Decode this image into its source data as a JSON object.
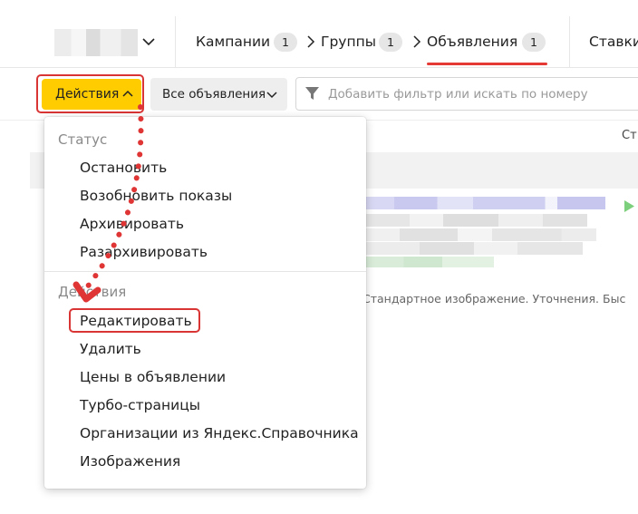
{
  "nav": {
    "crumbs": [
      {
        "label": "Кампании",
        "count": "1"
      },
      {
        "label": "Группы",
        "count": "1"
      },
      {
        "label": "Объявления",
        "count": "1"
      }
    ],
    "next_tab": "Ставки"
  },
  "toolbar": {
    "actions_label": "Действия",
    "all_ads_label": "Все объявления",
    "filter_placeholder": "Добавить фильтр или искать по номеру"
  },
  "table": {
    "column_header_partial": "Ст",
    "ad_caption": "Стандартное изображение. Уточнения. Быс"
  },
  "dropdown": {
    "status_group": {
      "label": "Статус",
      "items": [
        "Остановить",
        "Возобновить показы",
        "Архивировать",
        "Разархивировать"
      ]
    },
    "actions_group": {
      "label": "Действия",
      "items": [
        "Редактировать",
        "Удалить",
        "Цены в объявлении",
        "Турбо-страницы",
        "Организации из Яндекс.Справочника",
        "Изображения"
      ]
    }
  },
  "colors": {
    "actions_button": "#ffcc00",
    "highlight_frame": "#d93535",
    "active_tab_underline": "#e53935",
    "annotation_dots": "#e03535"
  },
  "icons": {
    "account_chevron": "chevron-down-icon",
    "breadcrumb_separator": "chevron-right-icon",
    "actions_chevron": "chevron-up-icon",
    "all_ads_chevron": "chevron-down-icon",
    "filter": "funnel-icon",
    "ad_status": "play-icon"
  }
}
